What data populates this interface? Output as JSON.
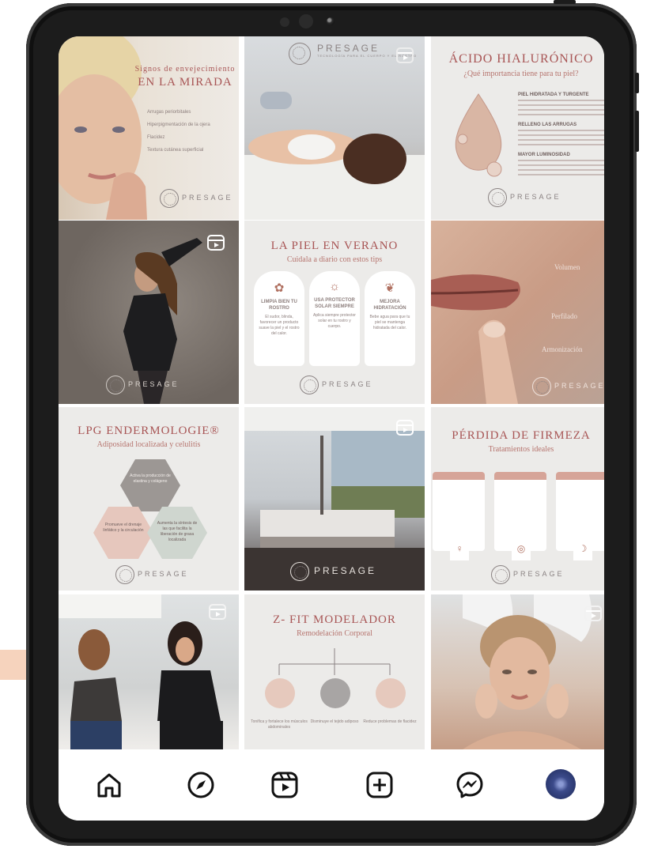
{
  "tiles": {
    "t1": {
      "title_small": "Signos de envejecimiento",
      "title": "EN LA MIRADA",
      "bullets": [
        "Arrugas periorbitales",
        "Hiperpigmentación de la ojera",
        "Flacidez",
        "Textura cutánea superficial"
      ]
    },
    "t2": {
      "brand": "PRESAGE",
      "tagline": "TECNOLOGÍA PARA EL CUERPO Y EL ROSTRO"
    },
    "t3": {
      "title": "ÁCIDO HIALURÓNICO",
      "subtitle": "¿Qué importancia tiene para tu piel?",
      "points": [
        "PIEL HIDRATADA Y TURGENTE",
        "RELLENO LAS ARRUGAS",
        "MAYOR LUMINOSIDAD"
      ]
    },
    "t5": {
      "title": "LA PIEL EN VERANO",
      "subtitle": "Cuidala a diario con estos tips",
      "cards": [
        {
          "label": "LIMPIA BIEN TU ROSTRO",
          "text": "El sudor, blinda, favorecer un producto suave la piel y el rostro del calor."
        },
        {
          "label": "USA PROTECTOR SOLAR SIEMPRE",
          "text": "Aplica siempre protector solar en tu rostro y cuerpo."
        },
        {
          "label": "MEJORA HIDRATACIÓN",
          "text": "Bebe agua para que tu piel se mantenga hidratada del calor."
        }
      ]
    },
    "t6": {
      "labels": [
        "Volumen",
        "Perfilado",
        "Armonización"
      ]
    },
    "t7": {
      "title": "LPG ENDERMOLOGIE®",
      "subtitle": "Adiposidad localizada y celulitis",
      "hexes": [
        "Activa la producción de elastina y colágeno",
        "Promueve el drenaje linfático y la circulación",
        "Aumenta la síntesis de las que facilita la liberación de grasa localizada"
      ]
    },
    "t9": {
      "title": "PÉRDIDA DE FIRMEZA",
      "subtitle": "Tratamientos ideales"
    },
    "t11": {
      "title": "Z- FIT MODELADOR",
      "subtitle": "Remodelación Corporal",
      "labels": [
        "Tonifica y fortalece los músculos abdominales",
        "Disminuye el tejido adiposo",
        "Reduce problemas de flacidez"
      ]
    }
  },
  "nav": {
    "items": [
      "home-icon",
      "explore-icon",
      "reels-icon",
      "create-icon",
      "messenger-icon",
      "profile-avatar"
    ]
  },
  "colors": {
    "accent": "#a85555",
    "bar": "#f6d3bd",
    "frame": "#1c1c1c"
  }
}
